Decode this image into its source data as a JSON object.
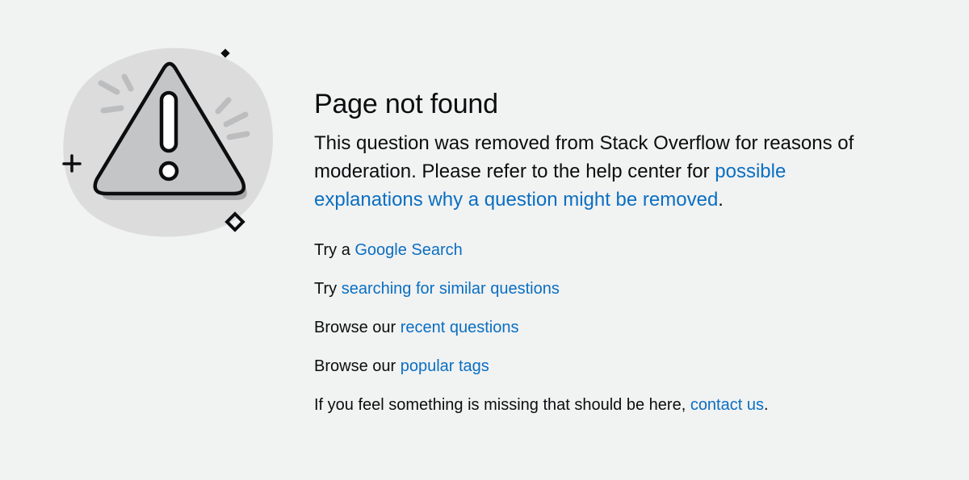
{
  "illustration": {
    "icon": "warning-triangle-icon",
    "colors": {
      "blob": "#dcdcdd",
      "triangle_fill": "#c4c5c6",
      "shadow": "#a9aaab",
      "outline": "#0c0d0e",
      "rays": "#bcbdbe"
    }
  },
  "page": {
    "title": "Page not found",
    "message": {
      "text": "This question was removed from Stack Overflow for reasons of moderation. Please refer to the help center for ",
      "link_label": "possible explanations why a question might be removed",
      "suffix": "."
    }
  },
  "links": [
    {
      "prefix": "Try a ",
      "label": "Google Search",
      "suffix": ""
    },
    {
      "prefix": "Try ",
      "label": "searching for similar questions",
      "suffix": ""
    },
    {
      "prefix": "Browse our ",
      "label": "recent questions",
      "suffix": ""
    },
    {
      "prefix": "Browse our ",
      "label": "popular tags",
      "suffix": ""
    },
    {
      "prefix": "If you feel something is missing that should be here, ",
      "label": "contact us",
      "suffix": "."
    }
  ],
  "theme": {
    "background": "#f1f2f2",
    "text": "#0c0d0e",
    "link": "#0a6fc2"
  }
}
